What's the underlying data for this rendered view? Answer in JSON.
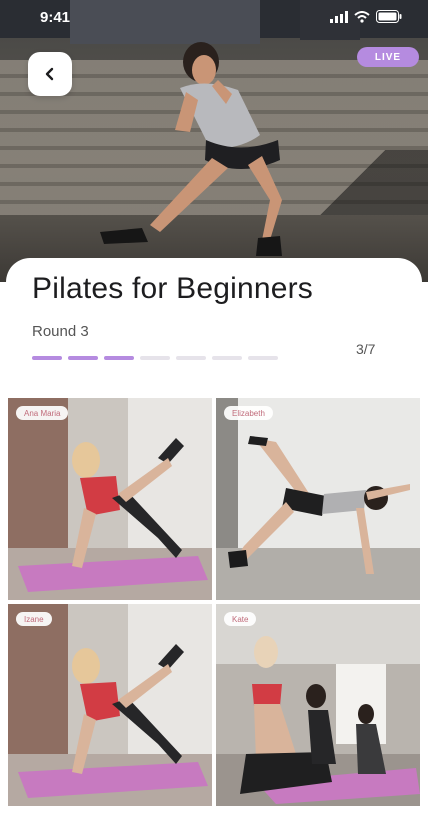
{
  "status_bar": {
    "time": "9:41"
  },
  "header": {
    "live_label": "LIVE"
  },
  "workout": {
    "title": "Pilates for Beginners",
    "round": "Round 3",
    "progress_count": "3/7",
    "progress": {
      "completed": 3,
      "total": 7
    }
  },
  "participants": [
    {
      "name": "Ana Maria"
    },
    {
      "name": "Elizabeth"
    },
    {
      "name": "Izane"
    },
    {
      "name": "Kate"
    }
  ],
  "colors": {
    "accent": "#b58be0",
    "mat": "#c77ac0",
    "tag_text": "#c06b7a"
  },
  "icons": {
    "back": "chevron-left-icon",
    "signal": "signal-icon",
    "wifi": "wifi-icon",
    "battery": "battery-icon"
  }
}
